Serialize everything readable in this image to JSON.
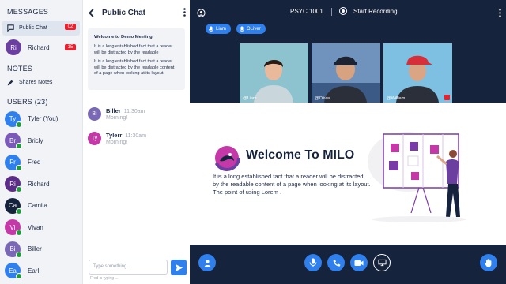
{
  "sidebar": {
    "messages_title": "MESSAGES",
    "public_chat": {
      "label": "Public Chat",
      "badge": "02"
    },
    "richard_dm": {
      "initials": "Ri",
      "label": "Richard",
      "badge": "15",
      "color": "#6b3fa0"
    },
    "notes_title": "NOTES",
    "shared_notes": "Shares Notes",
    "users_title": "USERS (23)",
    "users": [
      {
        "initials": "Ty",
        "name": "Tyler (You)",
        "color": "#2f80ed"
      },
      {
        "initials": "Br",
        "name": "Bricly",
        "color": "#7b59b8"
      },
      {
        "initials": "Fr",
        "name": "Fred",
        "color": "#2f80ed"
      },
      {
        "initials": "Ri",
        "name": "Richard",
        "color": "#5b2d86"
      },
      {
        "initials": "Ca",
        "name": "Camila",
        "color": "#16233d"
      },
      {
        "initials": "Vi",
        "name": "Vivan",
        "color": "#c438a8"
      },
      {
        "initials": "Bi",
        "name": "Biller",
        "color": "#7a67b5"
      },
      {
        "initials": "Ea",
        "name": "Earl",
        "color": "#2f80ed"
      }
    ]
  },
  "chat": {
    "title": "Public Chat",
    "welcome_title": "Welcome to Demo Meeting!",
    "welcome_p1": "It is a long established fact that a reader will be distracted by the readable",
    "welcome_p2": "It is a long established fact that a reader will be distracted by the readable content of a page when looking at its layout.",
    "messages": [
      {
        "initials": "Bi",
        "name": "Biller",
        "time": "11:30am",
        "text": "Morning!",
        "color": "#7a67b5"
      },
      {
        "initials": "Ty",
        "name": "Tylerr",
        "time": "11:30am",
        "text": "Morning!",
        "color": "#c438a8"
      }
    ],
    "input_placeholder": "Type something...",
    "typing": "Fred is typing ...",
    "accent": "#2f80ed"
  },
  "meeting": {
    "room": "PSYC 1001",
    "record_label": "Start Recording",
    "speakers": [
      "Liam",
      "OLiver"
    ],
    "tiles": [
      "@Liam",
      "@Oliver",
      "@William"
    ],
    "presentation_title": "Welcome To MILO",
    "presentation_text": "It is a long established fact that a reader will be distracted by the readable content of a page when looking at its layout. The point of using Lorem ."
  }
}
